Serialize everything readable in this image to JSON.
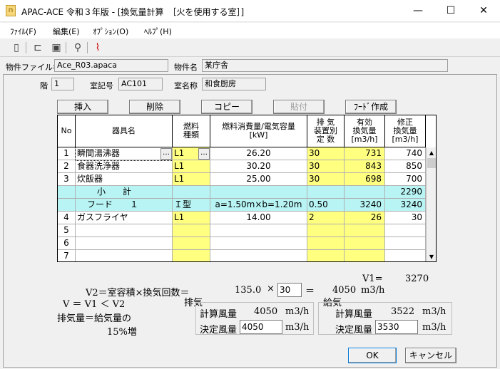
{
  "window": {
    "title": "APAC-ACE 令和３年版 - [換気量計算　［火を使用する室］]",
    "minimize": "—",
    "maximize": "☐",
    "close": "✕"
  },
  "menu": [
    "ﾌｧｲﾙ(F)",
    "編集(E)",
    "ｵﾌﾟｼｮﾝ(O)",
    "ﾍﾙﾌﾟ(H)"
  ],
  "project": {
    "file_label": "物件ファイル名",
    "file_value": "Ace_R03.apaca",
    "name_label": "物件名",
    "name_value": "某庁舎"
  },
  "room": {
    "floor_label": "階",
    "floor_value": "1",
    "code_label": "室記号",
    "code_value": "AC101",
    "name_label": "室名称",
    "name_value": "和食厨房"
  },
  "buttons": {
    "insert": "挿入",
    "delete": "削除",
    "copy": "コピー",
    "paste": "貼付",
    "hood": "ﾌｰﾄﾞ作成",
    "ok": "OK",
    "cancel": "キャンセル"
  },
  "table": {
    "headers": {
      "no": "No",
      "name": "器具名",
      "fuel": "燃料\n種類",
      "consumption": "燃料消費量/電気容量\n[kW]",
      "exhaust": "排 気\n装置別\n定 数",
      "effective": "有効\n換気量\n[m3/h]",
      "corrected": "修正\n換気量\n[m3/h]"
    },
    "rows": [
      {
        "no": "1",
        "name": "瞬間湯沸器",
        "fuel": "L1",
        "consumption": "26.20",
        "const": "30",
        "effective": "731",
        "corrected": "740"
      },
      {
        "no": "2",
        "name": "食器洗浄器",
        "fuel": "L1",
        "consumption": "30.20",
        "const": "30",
        "effective": "843",
        "corrected": "850"
      },
      {
        "no": "3",
        "name": "炊飯器",
        "fuel": "L1",
        "consumption": "25.00",
        "const": "30",
        "effective": "698",
        "corrected": "700"
      },
      {
        "name": "小　　計",
        "corrected": "2290"
      },
      {
        "name": "フード　　１",
        "fuel": "Ｉ型",
        "consumption": "a=1.50m×b=1.20m",
        "const": "0.50",
        "effective": "3240",
        "corrected": "3240"
      },
      {
        "no": "4",
        "name": "ガスフライヤ",
        "fuel": "L1",
        "consumption": "14.00",
        "const": "2",
        "effective": "26",
        "corrected": "30"
      },
      {
        "no": "5"
      },
      {
        "no": "6"
      },
      {
        "no": "7"
      }
    ],
    "ellipsis": "…"
  },
  "calc": {
    "v1_label": "V1=",
    "v1_value": "3270",
    "v2_formula": "V2＝室容積×換気回数＝",
    "volume": "135.0",
    "times": "×",
    "rate": "30",
    "equals": "＝",
    "v2_value": "4050",
    "unit": "m3/h",
    "relation": "V ＝ V1 ＜ V2",
    "note1": "排気量＝給気量の",
    "note2": "15%増"
  },
  "exhaust": {
    "title": "排気",
    "calc_label": "計算風量",
    "calc_value": "4050",
    "decided_label": "決定風量",
    "decided_value": "4050",
    "unit": "m3/h"
  },
  "supply": {
    "title": "給気",
    "calc_label": "計算風量",
    "calc_value": "3522",
    "decided_label": "決定風量",
    "decided_value": "3530",
    "unit": "m3/h"
  }
}
